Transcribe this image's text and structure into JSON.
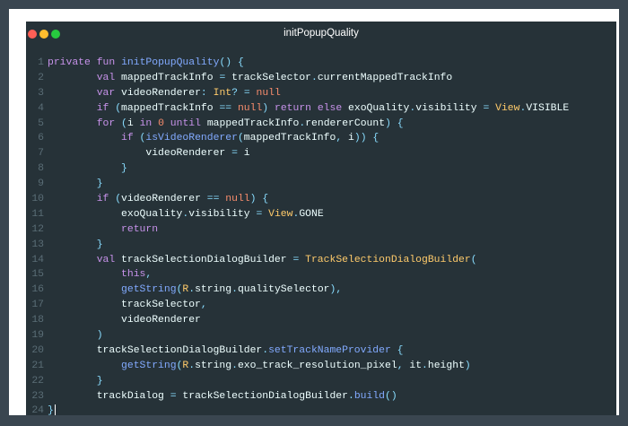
{
  "window": {
    "title": "initPopupQuality",
    "buttons": {
      "close_color": "#ff5f56",
      "minimize_color": "#ffbd2e",
      "maximize_color": "#27c93f"
    }
  },
  "theme": {
    "keyword": "#c792ea",
    "function": "#82aaff",
    "type": "#ffcb6b",
    "literal": "#f78c6c",
    "operator": "#89ddff",
    "text": "#eeffff"
  },
  "code": {
    "lines": [
      {
        "num": "1",
        "text": "private fun initPopupQuality() {"
      },
      {
        "num": "2",
        "text": "        val mappedTrackInfo = trackSelector.currentMappedTrackInfo"
      },
      {
        "num": "3",
        "text": "        var videoRenderer: Int? = null"
      },
      {
        "num": "4",
        "text": "        if (mappedTrackInfo == null) return else exoQuality.visibility = View.VISIBLE"
      },
      {
        "num": "5",
        "text": "        for (i in 0 until mappedTrackInfo.rendererCount) {"
      },
      {
        "num": "6",
        "text": "            if (isVideoRenderer(mappedTrackInfo, i)) {"
      },
      {
        "num": "7",
        "text": "                videoRenderer = i"
      },
      {
        "num": "8",
        "text": "            }"
      },
      {
        "num": "9",
        "text": "        }"
      },
      {
        "num": "10",
        "text": "        if (videoRenderer == null) {"
      },
      {
        "num": "11",
        "text": "            exoQuality.visibility = View.GONE"
      },
      {
        "num": "12",
        "text": "            return"
      },
      {
        "num": "13",
        "text": "        }"
      },
      {
        "num": "14",
        "text": "        val trackSelectionDialogBuilder = TrackSelectionDialogBuilder("
      },
      {
        "num": "15",
        "text": "            this,"
      },
      {
        "num": "16",
        "text": "            getString(R.string.qualitySelector),"
      },
      {
        "num": "17",
        "text": "            trackSelector,"
      },
      {
        "num": "18",
        "text": "            videoRenderer"
      },
      {
        "num": "19",
        "text": "        )"
      },
      {
        "num": "20",
        "text": "        trackSelectionDialogBuilder.setTrackNameProvider {"
      },
      {
        "num": "21",
        "text": "            getString(R.string.exo_track_resolution_pixel, it.height)"
      },
      {
        "num": "22",
        "text": "        }"
      },
      {
        "num": "23",
        "text": "        trackDialog = trackSelectionDialogBuilder.build()"
      },
      {
        "num": "24",
        "text": "}"
      }
    ]
  }
}
